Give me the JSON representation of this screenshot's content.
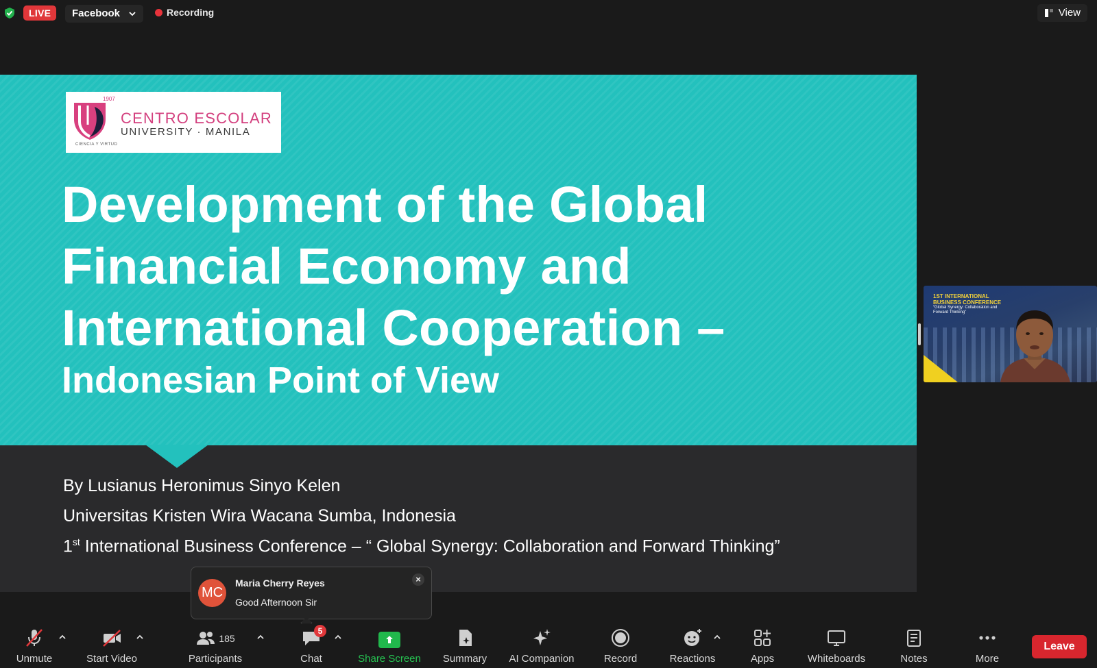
{
  "topbar": {
    "live_label": "LIVE",
    "platform_label": "Facebook",
    "recording_label": "Recording",
    "view_label": "View"
  },
  "slide": {
    "logo": {
      "year": "1907",
      "name_line1": "CENTRO ESCOLAR",
      "name_line2": "UNIVERSITY · MANILA",
      "motto": "CIENCIA Y VIRTUD"
    },
    "title_line1": "Development of the Global",
    "title_line2": "Financial Economy and",
    "title_line3": "International Cooperation –",
    "subtitle": "Indonesian Point of View",
    "author": "By Lusianus Heronimus Sinyo Kelen",
    "affiliation": "Universitas Kristen Wira Wacana Sumba, Indonesia",
    "conference_ordinal": "1",
    "conference_ordinal_suffix": "st",
    "conference": " International Business Conference – “ Global Synergy: Collaboration and Forward Thinking”"
  },
  "thumbnail": {
    "banner_line1": "1ST INTERNATIONAL",
    "banner_line2": "BUSINESS CONFERENCE",
    "banner_line3": "“Global Synergy: Collaboration and Forward Thinking”"
  },
  "chat_toast": {
    "initials": "MC",
    "sender": "Maria Cherry Reyes",
    "message": "Good Afternoon Sir",
    "avatar_color": "#e0533a"
  },
  "toolbar": {
    "unmute": "Unmute",
    "start_video": "Start Video",
    "participants": "Participants",
    "participants_count": "185",
    "chat": "Chat",
    "chat_badge": "5",
    "share_screen": "Share Screen",
    "summary": "Summary",
    "ai_companion": "AI Companion",
    "record": "Record",
    "reactions": "Reactions",
    "apps": "Apps",
    "whiteboards": "Whiteboards",
    "notes": "Notes",
    "more": "More",
    "leave": "Leave"
  },
  "colors": {
    "slide_teal": "#23c1bd",
    "live_red": "#e0373a",
    "share_green": "#21b84c",
    "leave_red": "#d8262e"
  }
}
